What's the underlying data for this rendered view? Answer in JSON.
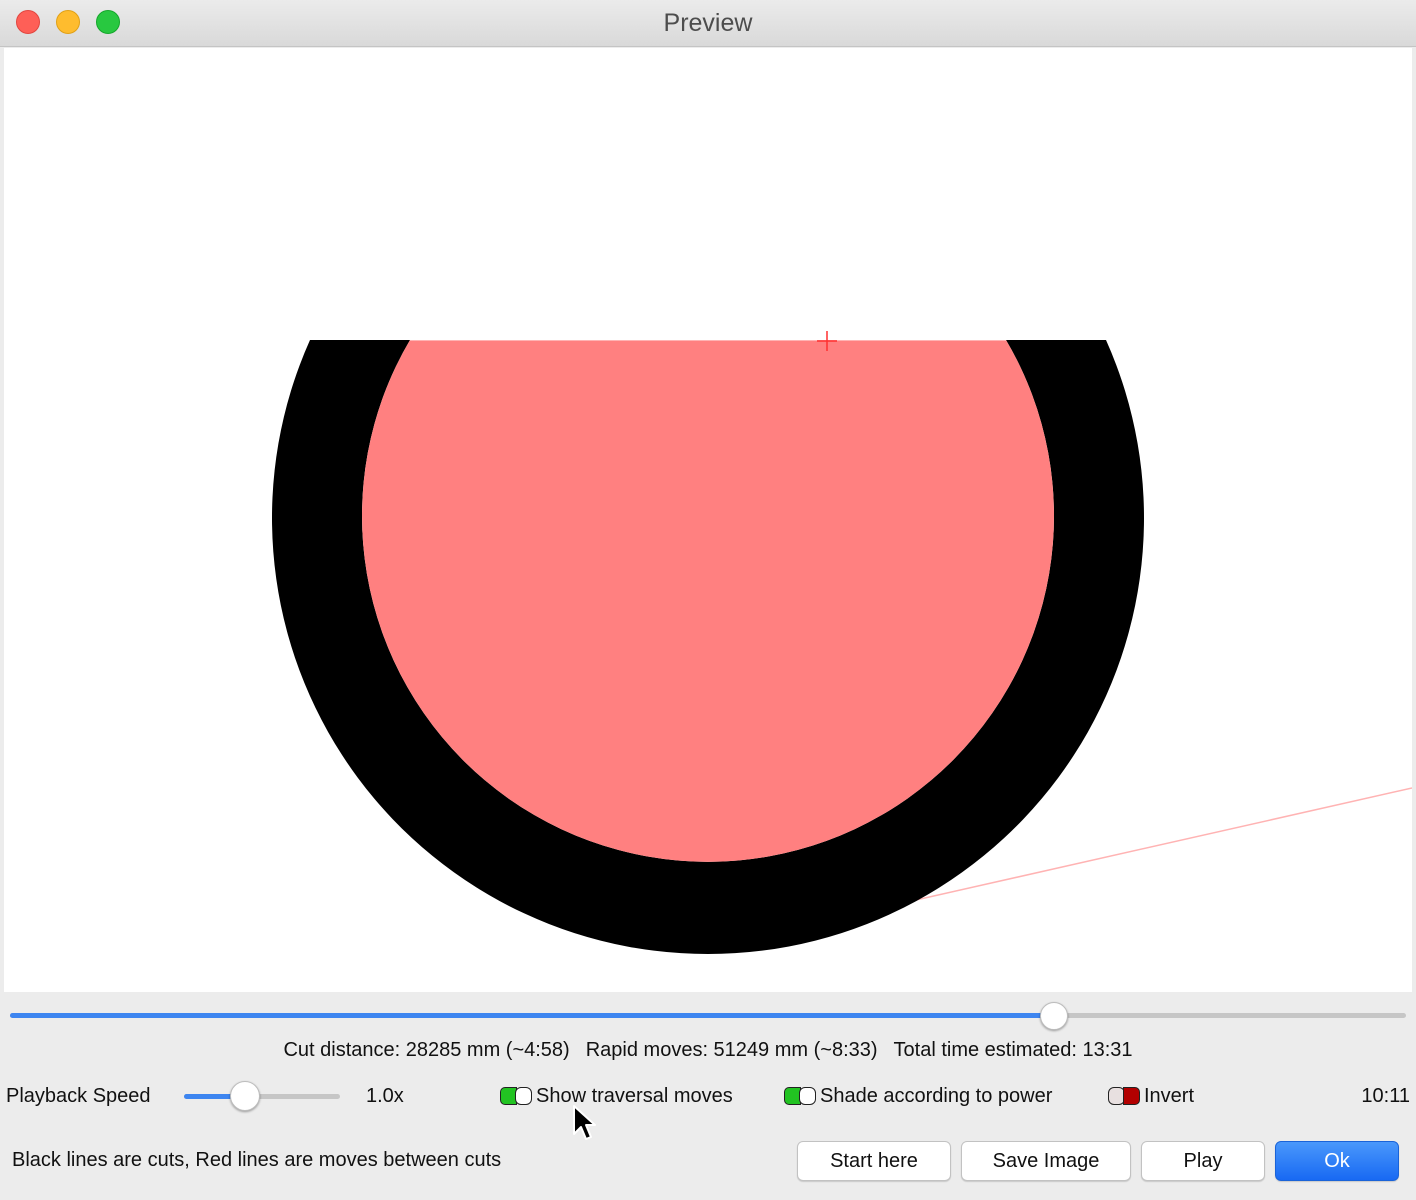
{
  "window": {
    "title": "Preview",
    "controls": [
      "close",
      "minimize",
      "zoom"
    ]
  },
  "timeline": {
    "progress": 0.748
  },
  "stats": {
    "cut_distance": "Cut distance: 28285 mm (~4:58)",
    "rapid_moves": "Rapid moves: 51249 mm (~8:33)",
    "total_time": "Total time estimated: 13:31"
  },
  "playback": {
    "label": "Playback Speed",
    "value": "1.0x",
    "slider_fraction": 0.39
  },
  "options": {
    "show_traversal": {
      "label": "Show traversal moves",
      "on": true
    },
    "shade_power": {
      "label": "Shade according to power",
      "on": true
    },
    "invert": {
      "label": "Invert",
      "on": false
    }
  },
  "current_time": "10:11",
  "legend_text": "Black lines are cuts, Red lines are moves between cuts",
  "buttons": {
    "start_here": "Start here",
    "save_image": "Save Image",
    "play": "Play",
    "ok": "Ok"
  },
  "colors": {
    "cut": "#000000",
    "move": "#ff8080",
    "accent": "#3d85f0",
    "toggle_on": "#22c322",
    "toggle_off": "#b30000"
  }
}
